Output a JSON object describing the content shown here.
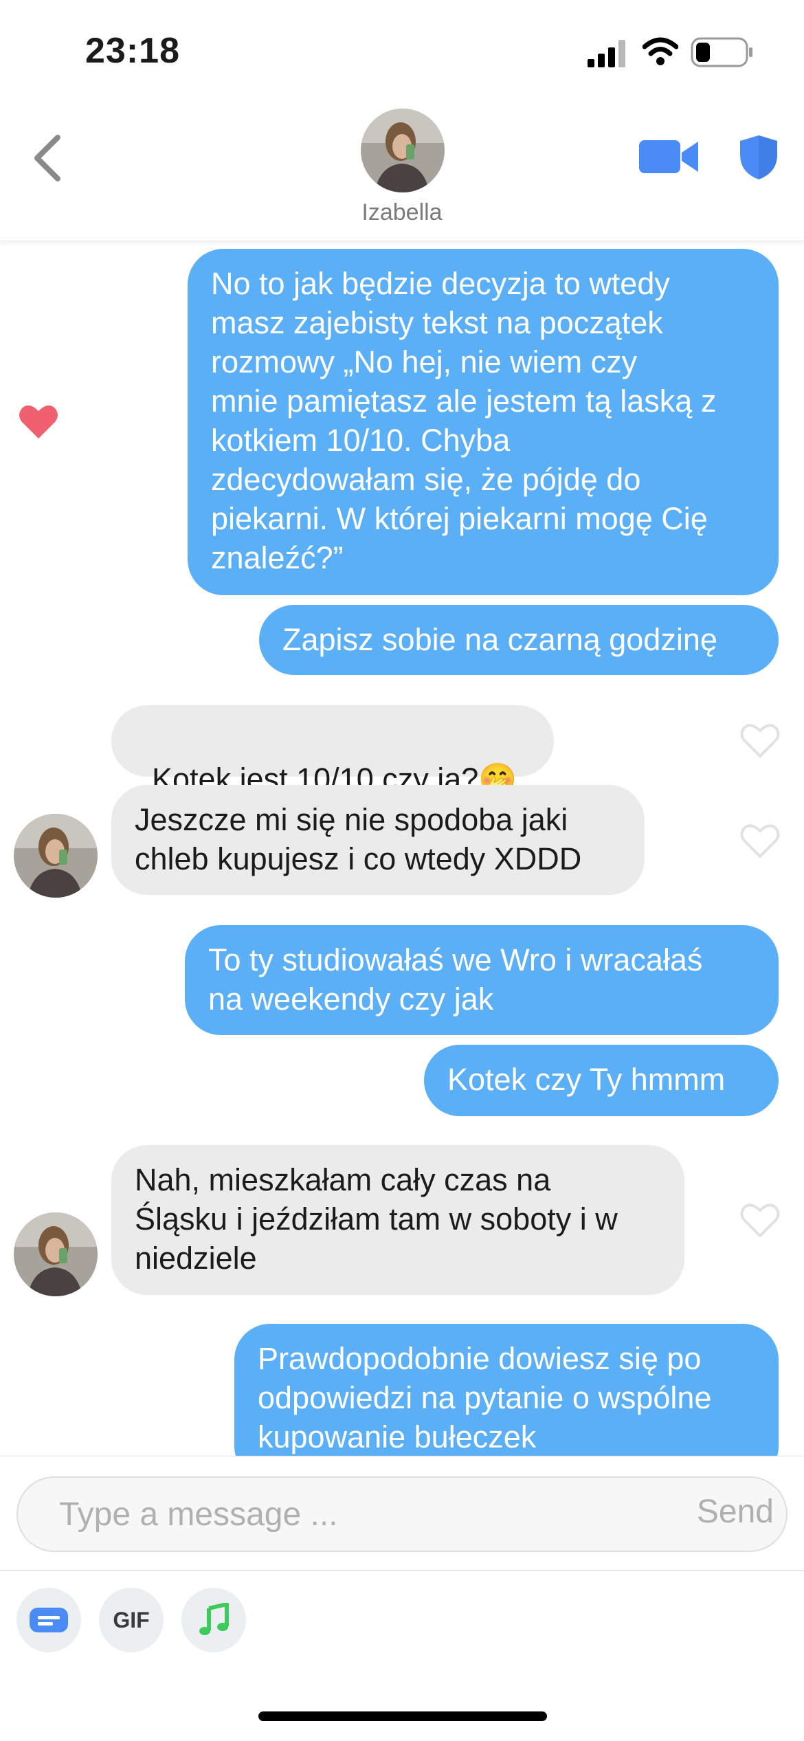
{
  "status_bar": {
    "time": "23:18",
    "battery_level": 0.3
  },
  "header": {
    "name": "Izabella",
    "back_icon": "chevron-left-icon",
    "video_icon": "video-camera-icon",
    "shield_icon": "shield-icon"
  },
  "colors": {
    "outgoing": "#5aaff6",
    "incoming": "#ebebeb",
    "accent": "#4a8bf5",
    "like": "#f0606f"
  },
  "messages": [
    {
      "from": "me",
      "text": "No to jak będzie decyzja to wtedy\nmasz zajebisty tekst na początek\nrozmowy „No hej, nie wiem czy\nmnie pamiętasz ale jestem tą laską z\nkotkiem 10/10. Chyba\nzdecydowałam się, że pójdę do\npiekarni. W której piekarni mogę Cię\nznaleźć?”",
      "liked": true
    },
    {
      "from": "me",
      "text": "Zapisz sobie na czarną godzinę"
    },
    {
      "from": "them",
      "text": "Kotek jest 10/10 czy ja?",
      "emoji": "🤭"
    },
    {
      "from": "them",
      "text": "Jeszcze mi się nie spodoba jaki\nchleb kupujesz i co wtedy XDDD"
    },
    {
      "from": "me",
      "text": "To ty studiowałaś we Wro i wracałaś\nna weekendy czy jak"
    },
    {
      "from": "me",
      "text": "Kotek czy Ty hmmm"
    },
    {
      "from": "them",
      "text": "Nah, mieszkałam cały czas na\nŚląsku i jeździłam tam w soboty i w\nniedziele"
    },
    {
      "from": "me",
      "text": "Prawdopodobnie dowiesz się po\nodpowiedzi na pytanie o wspólne\nkupowanie bułeczek"
    }
  ],
  "composer": {
    "placeholder": "Type a message ...",
    "value": "",
    "send_label": "Send"
  },
  "toolbar": {
    "gif_label": "GIF",
    "card_icon": "sticker-card-icon",
    "music_icon": "music-note-icon"
  }
}
